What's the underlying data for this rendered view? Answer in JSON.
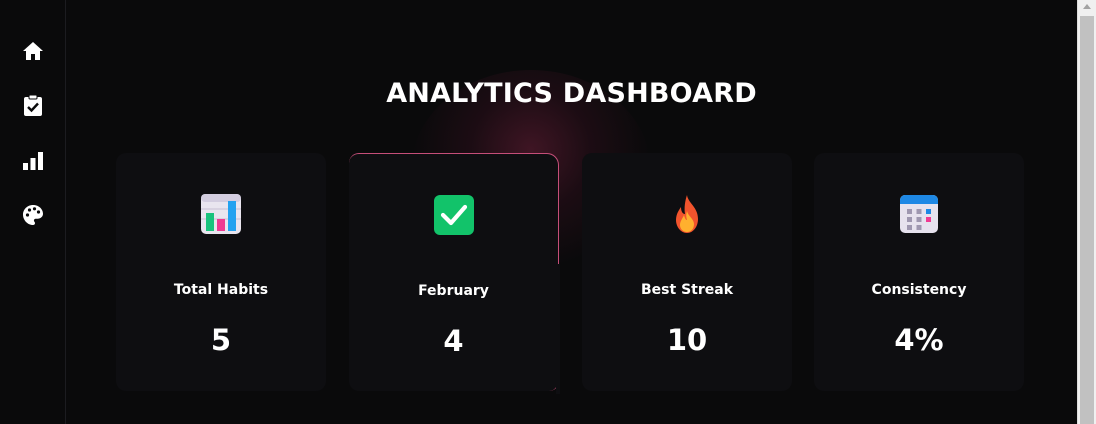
{
  "sidebar": {
    "items": [
      {
        "icon": "home-icon"
      },
      {
        "icon": "clipboard-check-icon"
      },
      {
        "icon": "bar-chart-icon"
      },
      {
        "icon": "palette-icon"
      }
    ]
  },
  "main": {
    "title": "ANALYTICS DASHBOARD",
    "cards": [
      {
        "icon": "bar-chart-emoji-icon",
        "label": "Total Habits",
        "value": "5"
      },
      {
        "icon": "check-mark-emoji-icon",
        "label": "February",
        "value": "4"
      },
      {
        "icon": "fire-emoji-icon",
        "label": "Best Streak",
        "value": "10"
      },
      {
        "icon": "calendar-emoji-icon",
        "label": "Consistency",
        "value": "4%"
      }
    ]
  },
  "colors": {
    "background": "#0a0a0b",
    "card": "#0e0e11",
    "accent_border": "#e65a8c",
    "text": "#ffffff"
  }
}
